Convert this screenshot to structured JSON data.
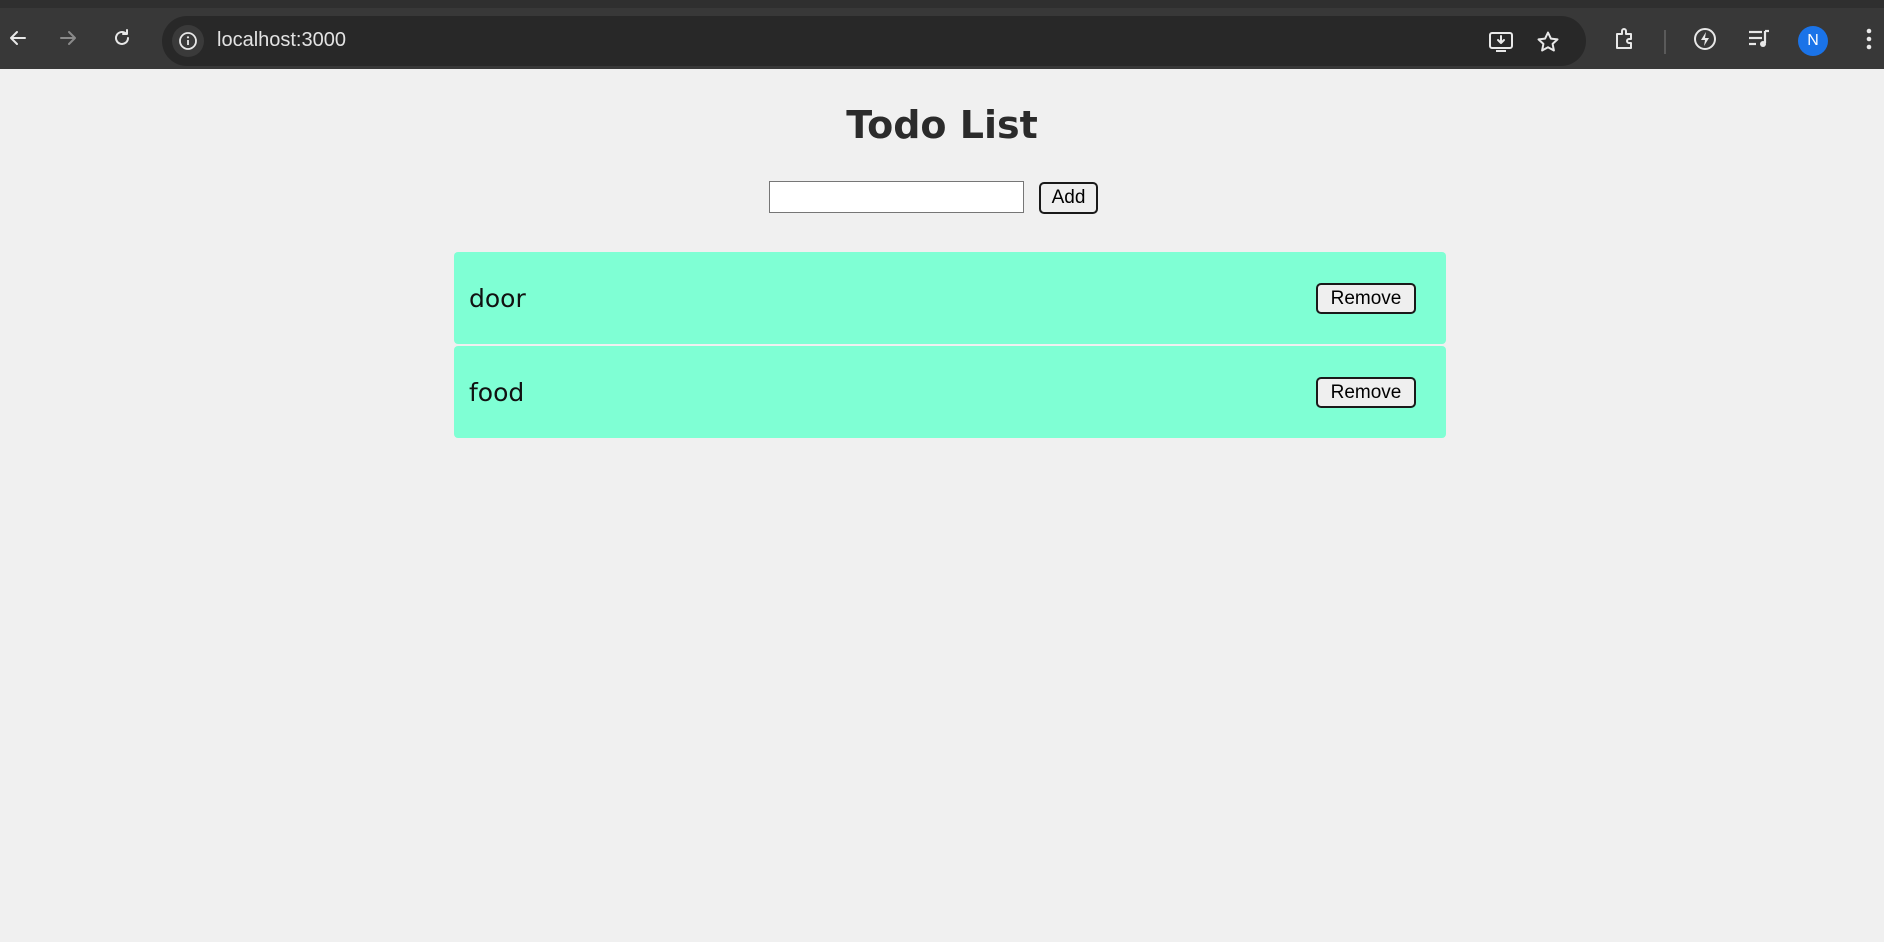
{
  "browser": {
    "url": "localhost:3000",
    "avatar_initial": "N",
    "accent_color": "#1a73e8"
  },
  "app": {
    "title": "Todo List",
    "input": {
      "value": "",
      "placeholder": ""
    },
    "add_label": "Add",
    "remove_label": "Remove",
    "item_color": "#7fffd4",
    "todos": [
      {
        "text": "door"
      },
      {
        "text": "food"
      }
    ]
  }
}
